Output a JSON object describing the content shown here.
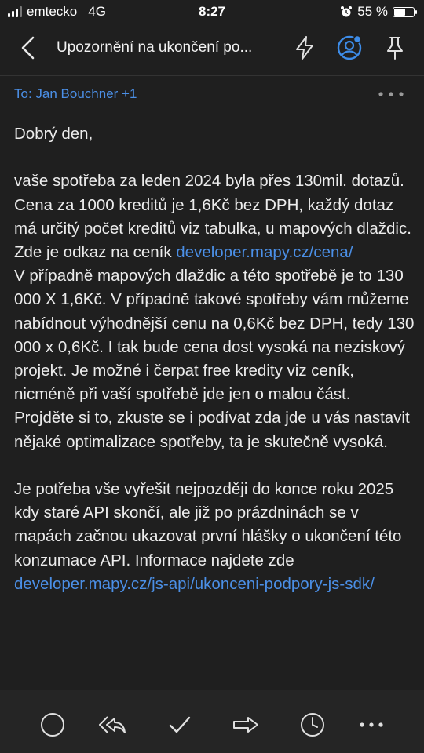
{
  "status": {
    "carrier": "emtecko",
    "network": "4G",
    "time": "8:27",
    "battery": "55 %"
  },
  "header": {
    "subject": "Upozornění na ukončení po..."
  },
  "recipients": {
    "label": "To: Jan Bouchner +1"
  },
  "email": {
    "greeting": "Dobrý den,",
    "p1": "vaše spotřeba za leden 2024 byla přes 130mil. dotazů. Cena za 1000 kreditů je 1,6Kč bez DPH, každý dotaz má určitý počet kreditů viz tabulka, u mapových dlaždic. Zde je odkaz na ceník ",
    "p1_link": "developer.mapy.cz/cena/",
    "p2": "V případně mapových dlaždic a této spotřebě je to 130 000 X 1,6Kč. V případně takové spotřeby vám můžeme nabídnout výhodnější cenu na 0,6Kč bez DPH, tedy 130 000 x 0,6Kč. I tak bude cena dost vysoká na neziskový projekt. Je možné i čerpat free kredity viz ceník, nicméně při vaší spotřebě jde jen o malou část.",
    "p3": "Projděte si to, zkuste se i podívat zda jde u vás nastavit nějaké optimalizace spotřeby, ta je skutečně vysoká.",
    "p4": "Je potřeba vše vyřešit nejpozději do konce roku 2025 kdy staré API skončí, ale již po prázdninách se v mapách začnou ukazovat první hlášky o ukončení této konzumace API. Informace najdete zde ",
    "p4_link": "developer.mapy.cz/js-api/ukonceni-podpory-js-sdk/"
  },
  "colors": {
    "background": "#1f1f1f",
    "link": "#4b8fe6",
    "accent": "#3d8ce8"
  }
}
